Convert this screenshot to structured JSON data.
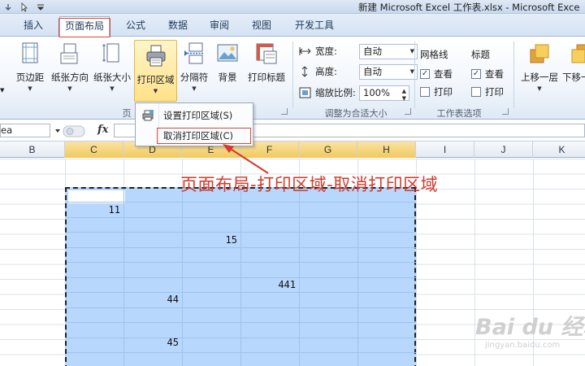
{
  "titlebar": {
    "title": "新建 Microsoft Excel 工作表.xlsx - Microsoft Exce"
  },
  "tabs": [
    {
      "id": "insert",
      "label": "插入"
    },
    {
      "id": "page-layout",
      "label": "页面布局",
      "active": true
    },
    {
      "id": "formulas",
      "label": "公式"
    },
    {
      "id": "data",
      "label": "数据"
    },
    {
      "id": "review",
      "label": "审阅"
    },
    {
      "id": "view",
      "label": "视图"
    },
    {
      "id": "developer",
      "label": "开发工具"
    }
  ],
  "ribbon": {
    "margins": "页边距",
    "orientation": "纸张方向",
    "size": "纸张大小",
    "print_area": "打印区域",
    "breaks": "分隔符",
    "background": "背景",
    "print_titles": "打印标题",
    "group_page_setup": "页",
    "scale": {
      "width_label": "宽度:",
      "width_value": "自动",
      "height_label": "高度:",
      "height_value": "自动",
      "scale_label": "缩放比例:",
      "scale_value": "100%",
      "group_label": "调整为合适大小"
    },
    "sheet_options": {
      "gridlines": "网格线",
      "headings": "标题",
      "view": "查看",
      "print": "打印",
      "group_label": "工作表选项"
    },
    "arrange": {
      "bring_forward": "上移一层",
      "send_backward": "下移一"
    }
  },
  "menu": {
    "set_print_area": "设置打印区域(S)",
    "clear_print_area": "取消打印区域(C)"
  },
  "formula_bar": {
    "name_box": "ea",
    "fx": "fx"
  },
  "columns": [
    "B",
    "C",
    "D",
    "E",
    "F",
    "G",
    "H",
    "I",
    "J",
    "K"
  ],
  "cells": {
    "c_11": "11",
    "e_15": "15",
    "f_441": "441",
    "d_44": "44",
    "d_45": "45"
  },
  "annotation": "页面布局-打印区域-取消打印区域",
  "watermark": {
    "main": "Bai du 经验",
    "sub": "jingyan.baidu.com"
  },
  "colors": {
    "accent_red": "#d23a2c",
    "selection_blue": "#b7d7fd",
    "ribbon_hover": "#ffe18a"
  }
}
